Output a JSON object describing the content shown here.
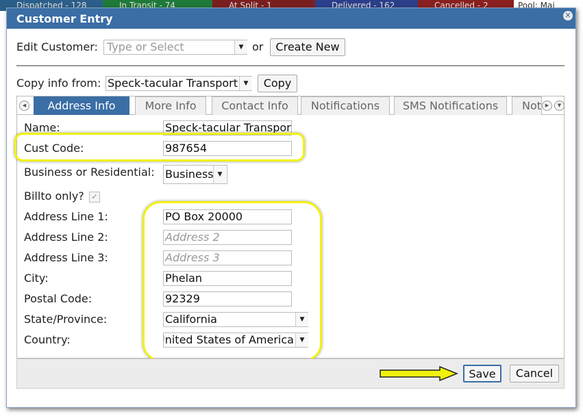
{
  "background_bar": [
    {
      "text": "Dispatched - 128",
      "color": "#2b5f8a"
    },
    {
      "text": "In Transit - 74",
      "color": "#1f7a3a"
    },
    {
      "text": "At Split - 1",
      "color": "#7a1f1f"
    },
    {
      "text": "Delivered - 162",
      "color": "#2b3f8a"
    },
    {
      "text": "Cancelled - 2",
      "color": "#8a1f1f"
    },
    {
      "text": "Pool: Mai",
      "color": "#ffffff"
    }
  ],
  "dialog": {
    "title": "Customer Entry",
    "close_icon": "close-icon"
  },
  "edit_customer": {
    "label": "Edit Customer:",
    "placeholder": "Type or Select",
    "or_text": "or",
    "create_new_label": "Create New"
  },
  "copy_info": {
    "label": "Copy info from:",
    "value": "Speck-tacular Transport",
    "copy_label": "Copy"
  },
  "tabs": [
    {
      "label": "Address Info",
      "active": true
    },
    {
      "label": "More Info",
      "active": false
    },
    {
      "label": "Contact Info",
      "active": false
    },
    {
      "label": "Notifications",
      "active": false
    },
    {
      "label": "SMS Notifications",
      "active": false
    },
    {
      "label": "Notes",
      "active": false
    }
  ],
  "form": {
    "name": {
      "label": "Name:",
      "value": "Speck-tacular Transport"
    },
    "cust_code": {
      "label": "Cust Code:",
      "value": "987654"
    },
    "business_residential": {
      "label": "Business or Residential:",
      "value": "Business"
    },
    "billto_only": {
      "label": "Billto only?",
      "checked": true
    },
    "address1": {
      "label": "Address Line 1:",
      "value": "PO Box 20000"
    },
    "address2": {
      "label": "Address Line 2:",
      "placeholder": "Address 2"
    },
    "address3": {
      "label": "Address Line 3:",
      "placeholder": "Address 3"
    },
    "city": {
      "label": "City:",
      "value": "Phelan"
    },
    "postal_code": {
      "label": "Postal Code:",
      "value": "92329"
    },
    "state": {
      "label": "State/Province:",
      "value": "California"
    },
    "country": {
      "label": "Country:",
      "value": "United States of America"
    }
  },
  "footer": {
    "save_label": "Save",
    "cancel_label": "Cancel"
  },
  "colors": {
    "titlebar": "#3a6ea5",
    "highlight": "#f1f10c",
    "active_tab": "#3a6ea5"
  }
}
